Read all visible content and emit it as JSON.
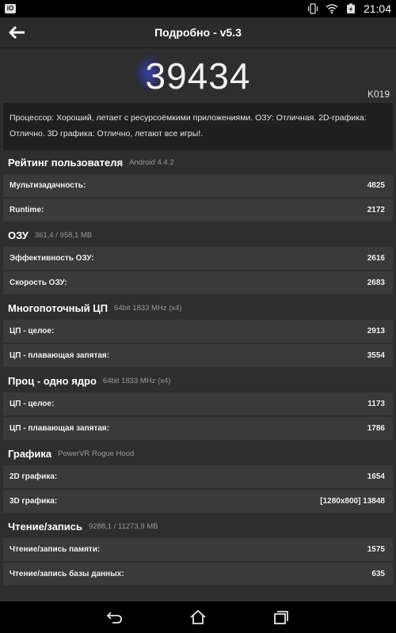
{
  "status_bar": {
    "time": "21:04",
    "icons": [
      "vibrate-icon",
      "wifi-icon",
      "battery-charging-icon"
    ],
    "app_icon_label": "iO"
  },
  "header": {
    "title": "Подробно - v5.3"
  },
  "score": {
    "value": "39434",
    "device": "K019"
  },
  "summary": "Процессор: Хороший, летает с ресурсоёмкими приложениями. ОЗУ: Отличная. 2D-графика: Отлично. 3D графика: Отлично, летают все игры!.",
  "sections": [
    {
      "title": "Рейтинг пользователя",
      "subtitle": "Android 4.4.2",
      "rows": [
        {
          "label": "Мультизадачность:",
          "value": "4825"
        },
        {
          "label": "Runtime:",
          "value": "2172"
        }
      ]
    },
    {
      "title": "ОЗУ",
      "subtitle": "361,4 / 958,1 MB",
      "rows": [
        {
          "label": "Эффективность ОЗУ:",
          "value": "2616"
        },
        {
          "label": "Скорость ОЗУ:",
          "value": "2683"
        }
      ]
    },
    {
      "title": "Многопоточный ЦП",
      "subtitle": "64bit 1833 MHz (x4)",
      "rows": [
        {
          "label": "ЦП - целое:",
          "value": "2913"
        },
        {
          "label": "ЦП - плавающая запятая:",
          "value": "3554"
        }
      ]
    },
    {
      "title": "Проц - одно ядро",
      "subtitle": "64bit 1833 MHz (x4)",
      "rows": [
        {
          "label": "ЦП - целое:",
          "value": "1173"
        },
        {
          "label": "ЦП - плавающая запятая:",
          "value": "1786"
        }
      ]
    },
    {
      "title": "Графика",
      "subtitle": "PowerVR Rogue Hood",
      "rows": [
        {
          "label": "2D графика:",
          "value": "1654"
        },
        {
          "label": "3D графика:",
          "value": "[1280x800] 13848"
        }
      ]
    },
    {
      "title": "Чтение/запись",
      "subtitle": "9288,1 / 11273,9 MB",
      "rows": [
        {
          "label": "Чтение/запись памяти:",
          "value": "1575"
        },
        {
          "label": "Чтение/запись базы данных:",
          "value": "635"
        }
      ]
    }
  ],
  "nav": {
    "icons": [
      "back-icon",
      "home-icon",
      "recents-icon"
    ]
  },
  "colors": {
    "background": "#2e2e2e",
    "row": "#3a3a3a",
    "summary": "#1f1f1f",
    "glow": "#3c46be"
  }
}
